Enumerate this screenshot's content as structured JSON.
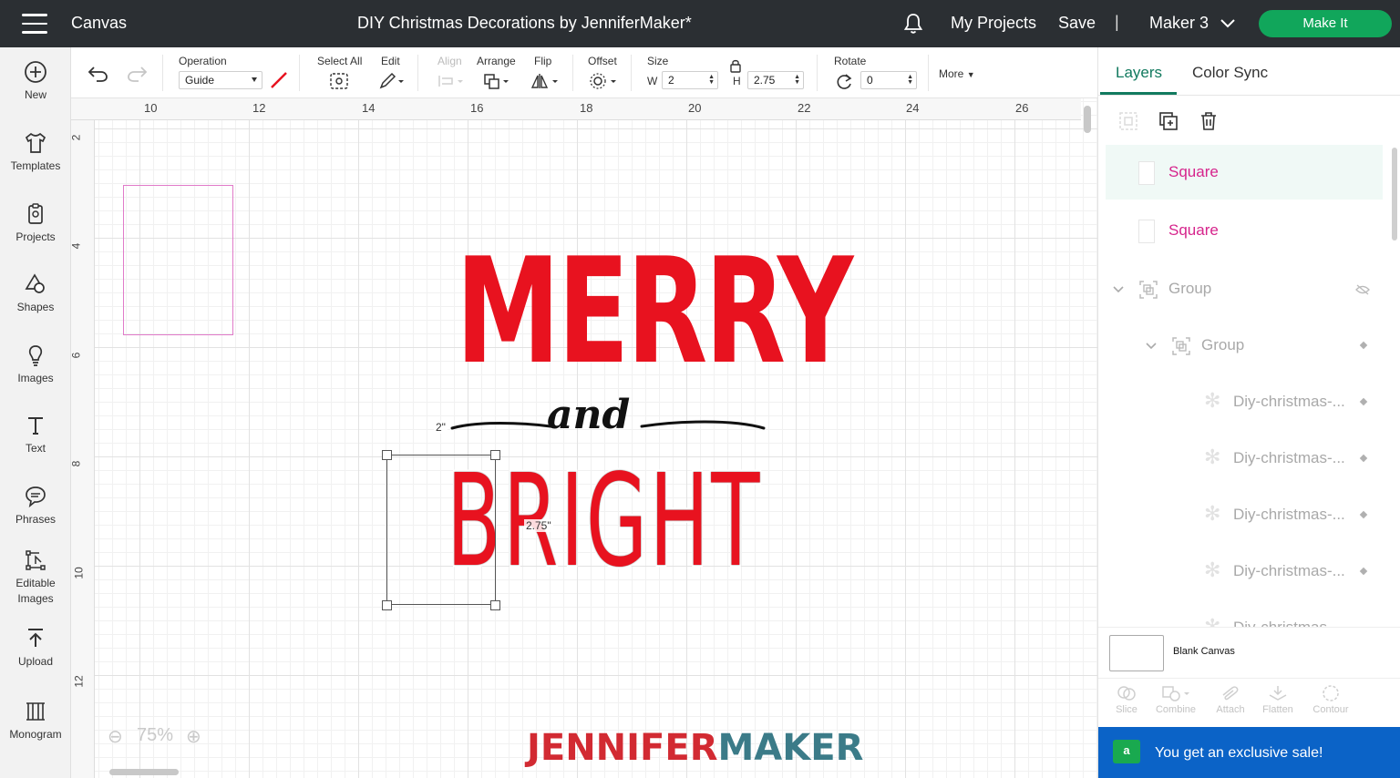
{
  "topbar": {
    "app_title": "Canvas",
    "doc_title": "DIY Christmas Decorations by JenniferMaker*",
    "my_projects": "My Projects",
    "save": "Save",
    "separator": "|",
    "machine": "Maker 3",
    "make_it": "Make It"
  },
  "sidebar": {
    "items": [
      {
        "label": "New",
        "icon": "plus-circle-icon"
      },
      {
        "label": "Templates",
        "icon": "shirt-icon"
      },
      {
        "label": "Projects",
        "icon": "clipboard-icon"
      },
      {
        "label": "Shapes",
        "icon": "shapes-icon"
      },
      {
        "label": "Images",
        "icon": "lightbulb-icon"
      },
      {
        "label": "Text",
        "icon": "text-icon"
      },
      {
        "label": "Phrases",
        "icon": "speech-bubble-icon"
      },
      {
        "label": "Editable Images",
        "icon": "editable-image-icon"
      },
      {
        "label": "Upload",
        "icon": "upload-icon"
      },
      {
        "label": "Monogram",
        "icon": "monogram-icon"
      }
    ]
  },
  "toolbar": {
    "operation_label": "Operation",
    "operation_value": "Guide",
    "select_all": "Select All",
    "edit": "Edit",
    "align": "Align",
    "arrange": "Arrange",
    "flip": "Flip",
    "offset": "Offset",
    "size": "Size",
    "width_label": "W",
    "width_value": "2",
    "height_label": "H",
    "height_value": "2.75",
    "rotate": "Rotate",
    "rotate_value": "0",
    "more": "More"
  },
  "canvas": {
    "ruler_top": [
      "10",
      "12",
      "14",
      "16",
      "18",
      "20",
      "22",
      "24",
      "26"
    ],
    "ruler_left": [
      "2",
      "4",
      "6",
      "8",
      "10",
      "12"
    ],
    "merry": "MERRY",
    "and": "and",
    "bright": "BRIGHT",
    "width_dim": "2\"",
    "height_dim": "2.75\"",
    "zoom_minus": "⊖",
    "zoom_value": "75%",
    "zoom_plus": "⊕",
    "brand_part1": "JENNIFER",
    "brand_part2": "MAKER"
  },
  "layers_panel": {
    "tab_layers": "Layers",
    "tab_color_sync": "Color Sync",
    "layers": [
      {
        "name": "Square",
        "color": "pink"
      },
      {
        "name": "Square",
        "color": "pink"
      },
      {
        "name": "Group",
        "color": "gray"
      },
      {
        "name": "Group",
        "color": "gray"
      },
      {
        "name": "Diy-christmas-...",
        "color": "gray"
      },
      {
        "name": "Diy-christmas-...",
        "color": "gray"
      },
      {
        "name": "Diy-christmas-...",
        "color": "gray"
      },
      {
        "name": "Diy-christmas-...",
        "color": "gray"
      },
      {
        "name": "Diy-christmas-...",
        "color": "gray"
      }
    ],
    "blank_canvas": "Blank Canvas",
    "tools": [
      "Slice",
      "Combine",
      "Attach",
      "Flatten",
      "Contour"
    ],
    "sale": "You get an exclusive sale!"
  },
  "colors": {
    "topbar": "#2b2f33",
    "make_it": "#11a65b",
    "accent": "#127a5f",
    "pink": "#d6248c",
    "red": "#e8121f",
    "sale": "#0b63c7"
  }
}
